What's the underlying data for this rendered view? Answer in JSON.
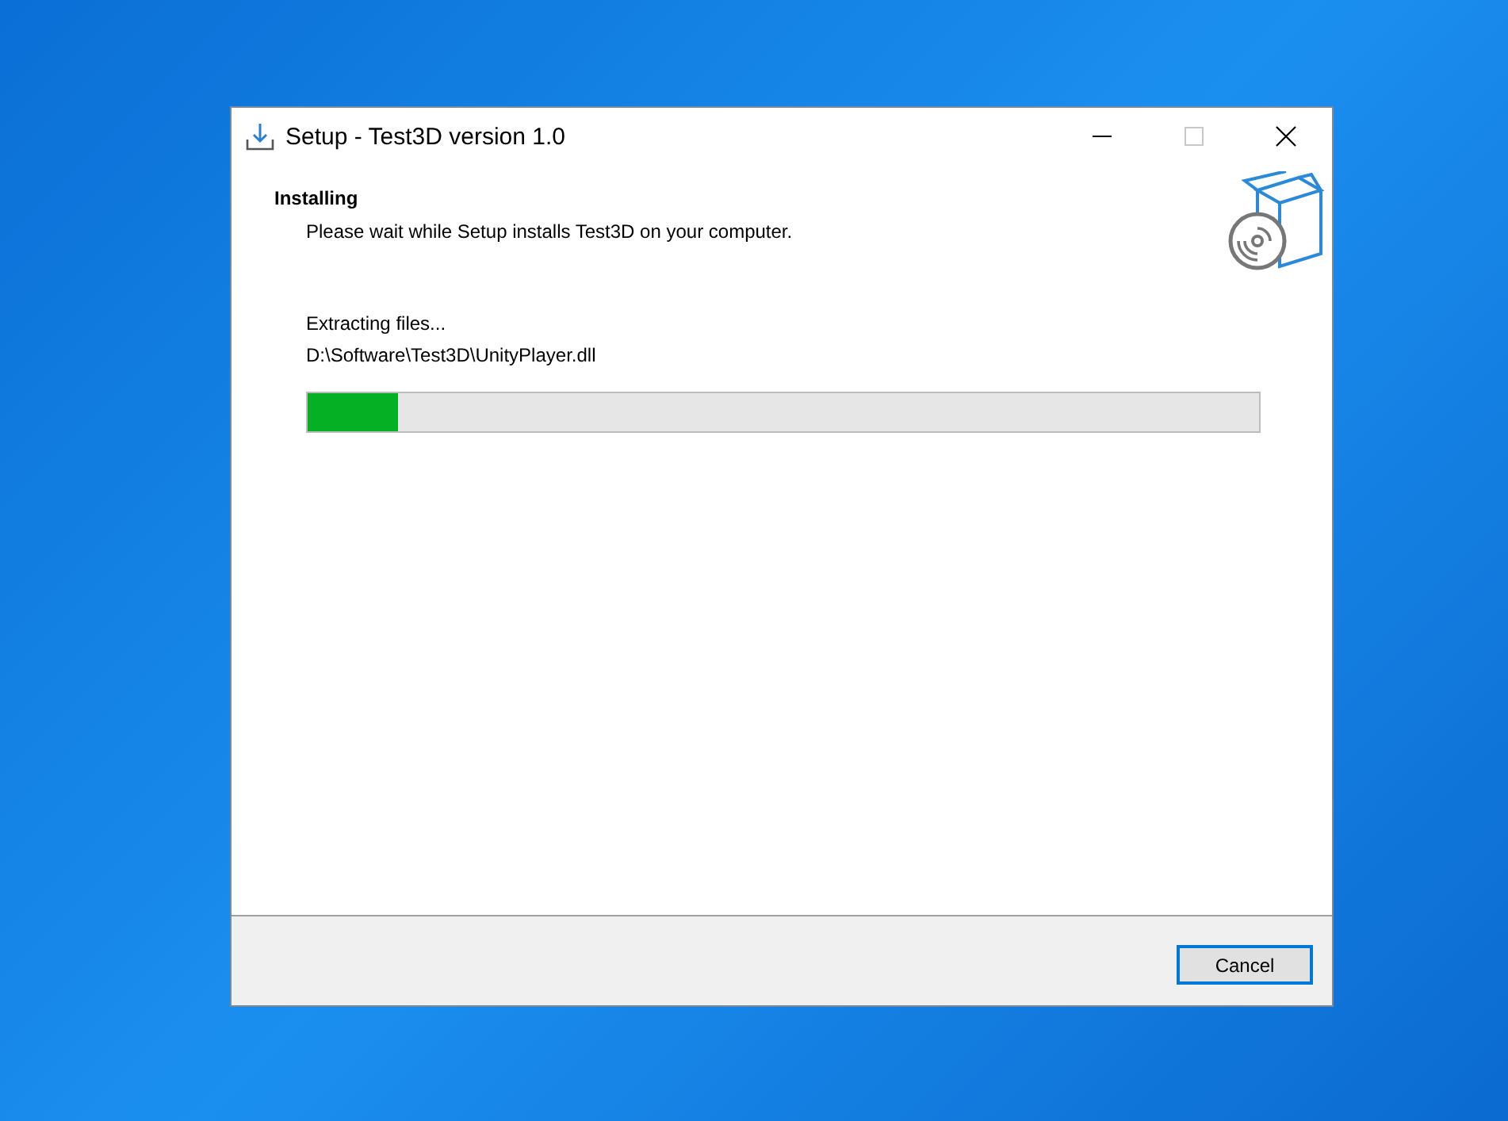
{
  "window": {
    "title": "Setup - Test3D version 1.0",
    "maximize_disabled": true
  },
  "header": {
    "title": "Installing",
    "subtitle": "Please wait while Setup installs Test3D on your computer."
  },
  "status": "Extracting files...",
  "current_file": "D:\\Software\\Test3D\\UnityPlayer.dll",
  "progress": {
    "level": 0.095
  },
  "buttons": [
    {
      "label": "Cancel",
      "focused": true
    }
  ]
}
